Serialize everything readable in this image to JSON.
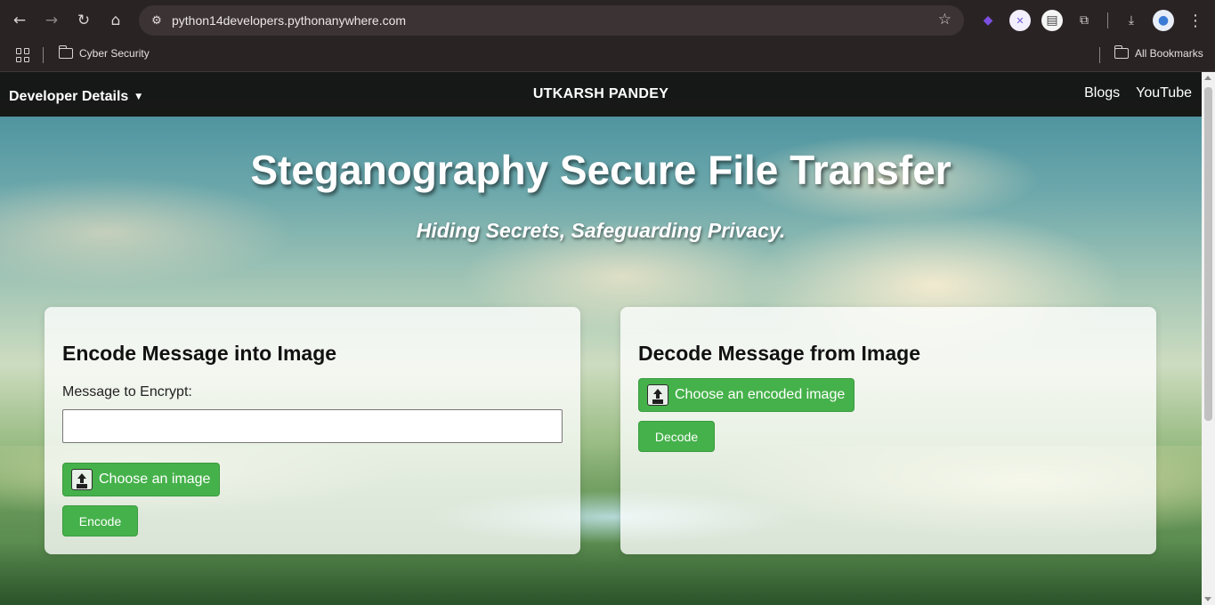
{
  "browser": {
    "url": "python14developers.pythonanywhere.com",
    "nav": {
      "back_icon": "←",
      "forward_icon": "→",
      "reload_icon": "↻",
      "home_icon": "⌂"
    },
    "omnibox_icons": {
      "site_info_icon": "⚙",
      "star_icon": "☆"
    },
    "extensions": [
      {
        "name": "flame-extension-icon",
        "glyph": "◆",
        "color": "#7b4fe0"
      },
      {
        "name": "profile-extension-icon",
        "glyph": "✕",
        "color": "#6a5acd"
      },
      {
        "name": "document-extension-icon",
        "glyph": "▤",
        "color": "#444444"
      },
      {
        "name": "puzzle-extensions-icon",
        "glyph": "⧉",
        "color": "#d9d3d4"
      },
      {
        "name": "download-icon",
        "glyph": "⤓",
        "color": "#d9d3d4"
      },
      {
        "name": "profile-avatar-icon",
        "glyph": "●",
        "color": "#3a7bd5"
      },
      {
        "name": "menu-kebab-icon",
        "glyph": "⋮",
        "color": "#d9d3d4"
      }
    ],
    "bookmarks": {
      "items": [
        {
          "label": "Cyber Security"
        }
      ],
      "all_bookmarks_label": "All Bookmarks"
    }
  },
  "page": {
    "navbar": {
      "dropdown_label": "Developer Details",
      "dropdown_caret": "▼",
      "brand": "UTKARSH PANDEY",
      "links": [
        {
          "label": "Blogs"
        },
        {
          "label": "YouTube"
        }
      ]
    },
    "hero": {
      "title": "Steganography Secure File Transfer",
      "subtitle": "Hiding Secrets, Safeguarding Privacy."
    },
    "encode_card": {
      "heading": "Encode Message into Image",
      "message_label": "Message to Encrypt:",
      "message_value": "",
      "file_button_label": "Choose an image",
      "submit_label": "Encode"
    },
    "decode_card": {
      "heading": "Decode Message from Image",
      "file_button_label": "Choose an encoded image",
      "submit_label": "Decode"
    }
  },
  "colors": {
    "accent_green": "#45b14a",
    "navbar_bg": "#141210",
    "chrome_bg": "#2a2324"
  }
}
